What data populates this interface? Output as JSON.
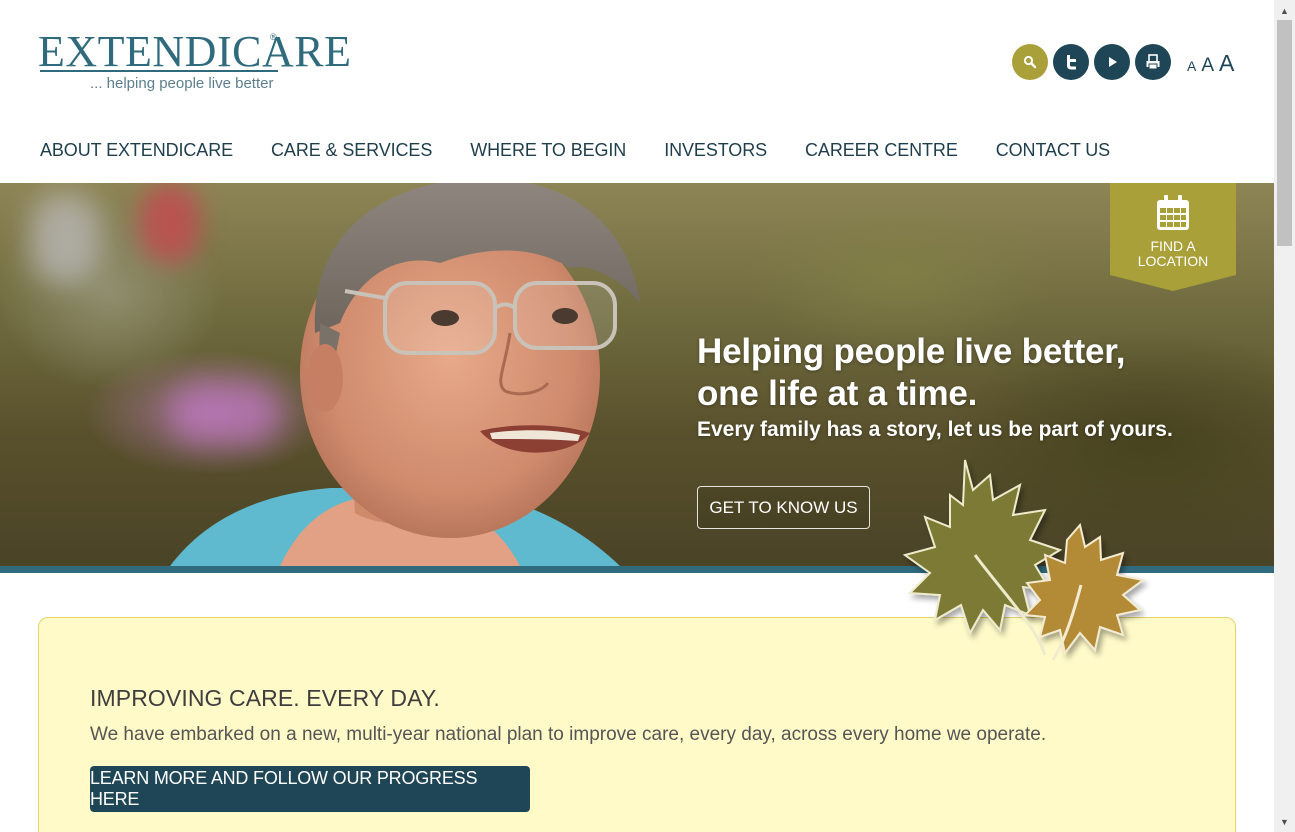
{
  "logo": {
    "word": "EXTENDICARE",
    "registered": "®",
    "tagline": "... helping people live better"
  },
  "social": [
    {
      "name": "search-icon"
    },
    {
      "name": "twitter-icon"
    },
    {
      "name": "youtube-icon"
    },
    {
      "name": "print-icon"
    }
  ],
  "text_size": {
    "small": "A",
    "medium": "A",
    "large": "A"
  },
  "nav": [
    "ABOUT EXTENDICARE",
    "CARE & SERVICES",
    "WHERE TO BEGIN",
    "INVESTORS",
    "CAREER CENTRE",
    "CONTACT US"
  ],
  "hero": {
    "headline_1": "Helping people live better,",
    "headline_2": "one life at a time.",
    "subhead": "Every family has a story, let us be part of yours.",
    "button": "GET TO KNOW US",
    "find_location_1": "FIND A",
    "find_location_2": "LOCATION"
  },
  "callout": {
    "title": "IMPROVING CARE. EVERY DAY.",
    "text": "We have embarked on a new, multi-year national plan to improve care, every day, across every home we operate.",
    "button": "LEARN MORE AND FOLLOW OUR PROGRESS HERE"
  },
  "colors": {
    "brand_teal": "#2f6b7d",
    "navy": "#1f4656",
    "olive": "#a9a03a",
    "callout_bg": "#fffac8"
  }
}
